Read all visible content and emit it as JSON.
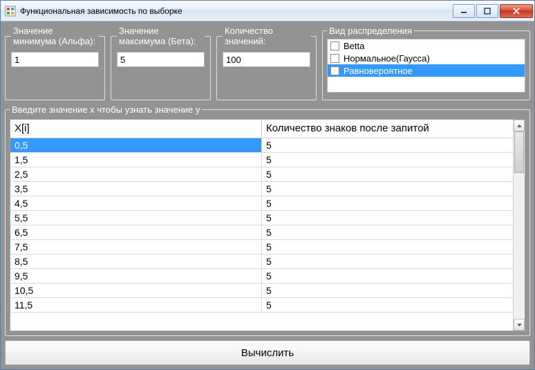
{
  "window": {
    "title": "Функциональная зависимость по выборке"
  },
  "groups": {
    "min": {
      "legend": "Значение минимума (Альфа):",
      "value": "1"
    },
    "max": {
      "legend": "Значение максимума (Бета):",
      "value": "5"
    },
    "count": {
      "legend": "Количество значений:",
      "value": "100"
    },
    "dist": {
      "legend": "Вид распределения",
      "items": [
        "Betta",
        "Нормальное(Гаусса)",
        "Равновероятное"
      ],
      "selected_index": 2
    },
    "xy": {
      "legend": "Введите значение x чтобы узнать значение y",
      "columns": [
        "X[i]",
        "Количество знаков после запитой"
      ],
      "rows": [
        {
          "x": "0,5",
          "d": "5"
        },
        {
          "x": "1,5",
          "d": "5"
        },
        {
          "x": "2,5",
          "d": "5"
        },
        {
          "x": "3,5",
          "d": "5"
        },
        {
          "x": "4,5",
          "d": "5"
        },
        {
          "x": "5,5",
          "d": "5"
        },
        {
          "x": "6,5",
          "d": "5"
        },
        {
          "x": "7,5",
          "d": "5"
        },
        {
          "x": "8,5",
          "d": "5"
        },
        {
          "x": "9,5",
          "d": "5"
        },
        {
          "x": "10,5",
          "d": "5"
        },
        {
          "x": "11,5",
          "d": "5"
        }
      ],
      "selected_row": 0
    }
  },
  "calc_button": "Вычислить"
}
